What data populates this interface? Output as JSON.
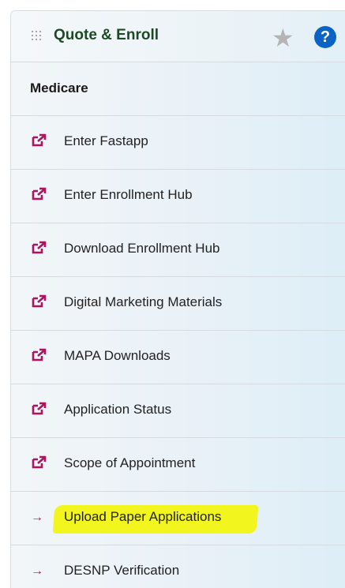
{
  "header": {
    "title": "Quote & Enroll",
    "star": "★",
    "help": "?"
  },
  "section": {
    "label": "Medicare"
  },
  "items": [
    {
      "label": "Enter Fastapp",
      "icon": "external-link-icon"
    },
    {
      "label": "Enter Enrollment Hub",
      "icon": "external-link-icon"
    },
    {
      "label": "Download Enrollment Hub",
      "icon": "external-link-icon"
    },
    {
      "label": "Digital Marketing Materials",
      "icon": "external-link-icon"
    },
    {
      "label": "MAPA Downloads",
      "icon": "external-link-icon"
    },
    {
      "label": "Application Status",
      "icon": "external-link-icon"
    },
    {
      "label": "Scope of Appointment",
      "icon": "external-link-icon"
    },
    {
      "label": "Upload Paper Applications",
      "icon": "arrow-right-icon",
      "highlighted": true
    },
    {
      "label": "DESNP Verification",
      "icon": "arrow-right-icon"
    }
  ],
  "arrow_glyph": "→",
  "colors": {
    "title": "#1c4a24",
    "icon": "#b0125e",
    "help": "#0b63c4",
    "highlight": "#f3f51e"
  }
}
